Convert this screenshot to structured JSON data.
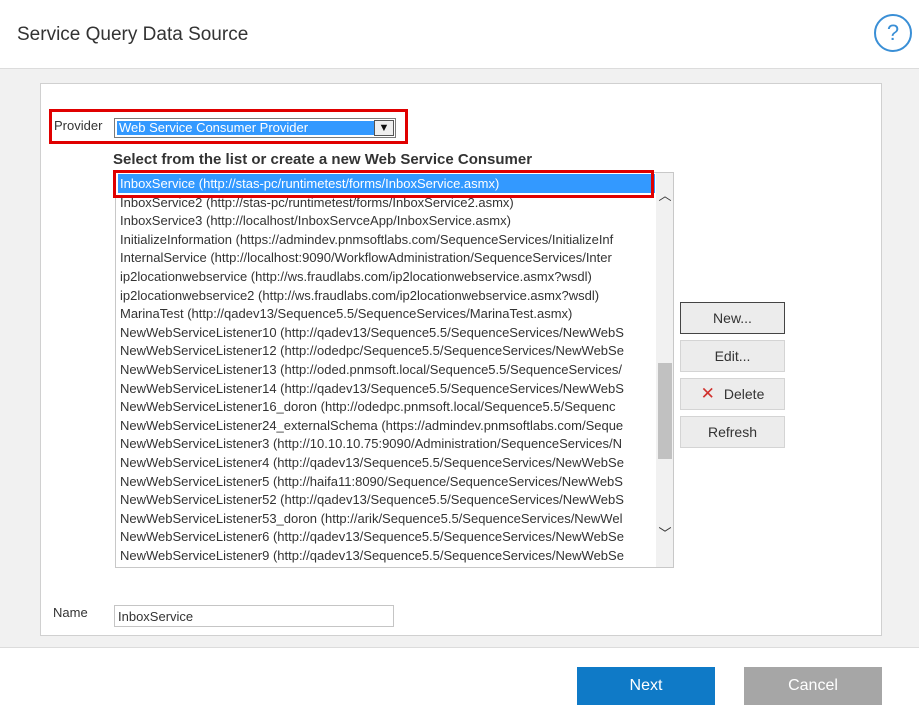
{
  "dialog": {
    "title": "Service Query Data Source",
    "help_label": "?"
  },
  "provider": {
    "label": "Provider",
    "selected": "Web Service Consumer Provider",
    "dropdown_glyph": "▼"
  },
  "list": {
    "heading": "Select from the list or create a new Web Service Consumer",
    "items": [
      "InboxService (http://stas-pc/runtimetest/forms/InboxService.asmx)",
      "InboxService2 (http://stas-pc/runtimetest/forms/InboxService2.asmx)",
      "InboxService3 (http://localhost/InboxServceApp/InboxService.asmx)",
      "InitializeInformation (https://admindev.pnmsoftlabs.com/SequenceServices/InitializeInf",
      "InternalService (http://localhost:9090/WorkflowAdministration/SequenceServices/Inter",
      "ip2locationwebservice (http://ws.fraudlabs.com/ip2locationwebservice.asmx?wsdl)",
      "ip2locationwebservice2 (http://ws.fraudlabs.com/ip2locationwebservice.asmx?wsdl)",
      "MarinaTest (http://qadev13/Sequence5.5/SequenceServices/MarinaTest.asmx)",
      "NewWebServiceListener10 (http://qadev13/Sequence5.5/SequenceServices/NewWebS",
      "NewWebServiceListener12 (http://odedpc/Sequence5.5/SequenceServices/NewWebSe",
      "NewWebServiceListener13 (http://oded.pnmsoft.local/Sequence5.5/SequenceServices/",
      "NewWebServiceListener14 (http://qadev13/Sequence5.5/SequenceServices/NewWebS",
      "NewWebServiceListener16_doron (http://odedpc.pnmsoft.local/Sequence5.5/Sequenc",
      "NewWebServiceListener24_externalSchema (https://admindev.pnmsoftlabs.com/Seque",
      "NewWebServiceListener3 (http://10.10.10.75:9090/Administration/SequenceServices/N",
      "NewWebServiceListener4 (http://qadev13/Sequence5.5/SequenceServices/NewWebSe",
      "NewWebServiceListener5 (http://haifa11:8090/Sequence/SequenceServices/NewWebS",
      "NewWebServiceListener52 (http://qadev13/Sequence5.5/SequenceServices/NewWebS",
      "NewWebServiceListener53_doron (http://arik/Sequence5.5/SequenceServices/NewWel",
      "NewWebServiceListener6 (http://qadev13/Sequence5.5/SequenceServices/NewWebSe",
      "NewWebServiceListener9 (http://qadev13/Sequence5.5/SequenceServices/NewWebSe"
    ],
    "selected_index": 0,
    "scroll_up": "︿",
    "scroll_down": "﹀"
  },
  "actions": {
    "new": "New...",
    "edit": "Edit...",
    "delete": "Delete",
    "delete_icon": "✕",
    "refresh": "Refresh"
  },
  "name": {
    "label": "Name",
    "value": "InboxService"
  },
  "footer": {
    "next": "Next",
    "cancel": "Cancel"
  },
  "colors": {
    "accent": "#0f7ac7",
    "selection": "#3399ff",
    "highlight": "#e00000",
    "delete": "#d0312d",
    "cancel": "#a6a6a6"
  }
}
